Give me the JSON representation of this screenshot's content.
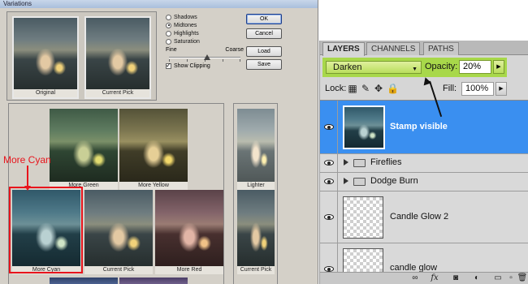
{
  "variations_dialog": {
    "title": "Variations",
    "original_caption": "Original",
    "current_pick_caption": "Current Pick",
    "tone_options": [
      {
        "label": "Shadows",
        "selected": false
      },
      {
        "label": "Midtones",
        "selected": true
      },
      {
        "label": "Highlights",
        "selected": false
      },
      {
        "label": "Saturation",
        "selected": false
      }
    ],
    "fine_label": "Fine",
    "coarse_label": "Coarse",
    "show_clipping_label": "Show Clipping",
    "show_clipping_checked": true,
    "buttons": {
      "ok": "OK",
      "cancel": "Cancel",
      "load": "Load",
      "save": "Save"
    },
    "variants": {
      "more_green": "More Green",
      "more_yellow": "More Yellow",
      "more_cyan": "More Cyan",
      "current_pick": "Current Pick",
      "more_red": "More Red"
    },
    "lighter_label": "Lighter",
    "lighter_current_pick": "Current Pick",
    "callout_text": "More Cyan",
    "callout_color": "#e8141c"
  },
  "layers_panel": {
    "tabs": [
      "LAYERS",
      "CHANNELS",
      "PATHS"
    ],
    "active_tab": "LAYERS",
    "blend_mode": "Darken",
    "opacity_label": "Opacity:",
    "opacity_value": "20%",
    "highlight_color": "#a8d84a",
    "lock_label": "Lock:",
    "fill_label": "Fill:",
    "fill_value": "100%",
    "layers": [
      {
        "name": "Stamp visible",
        "type": "image",
        "selected": true
      },
      {
        "name": "Fireflies",
        "type": "group"
      },
      {
        "name": "Dodge Burn",
        "type": "group"
      },
      {
        "name": "Candle Glow 2",
        "type": "transparent"
      },
      {
        "name": "candle glow",
        "type": "transparent"
      }
    ],
    "selection_color": "#3a8ff0",
    "footer_icons": [
      "link-icon",
      "fx-icon",
      "mask-icon",
      "adjustment-icon",
      "new-group-icon",
      "new-layer-icon",
      "trash-icon"
    ]
  }
}
